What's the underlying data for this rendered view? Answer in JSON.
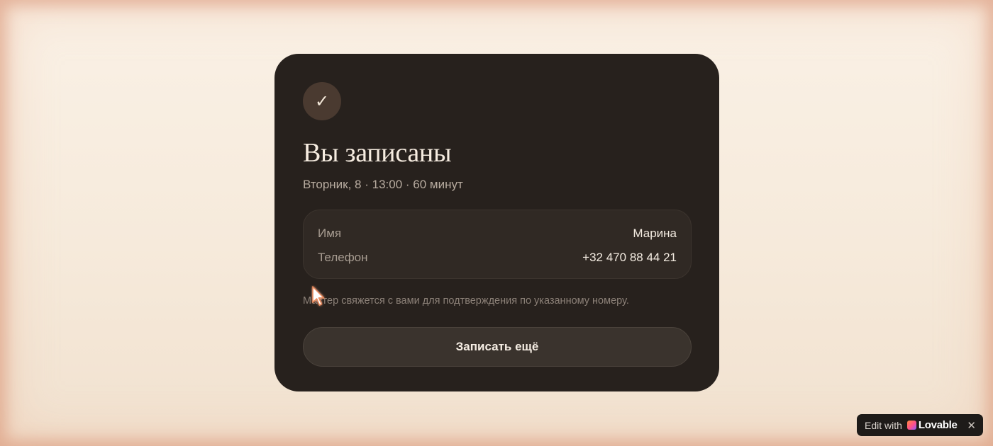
{
  "confirmation": {
    "check_glyph": "✓",
    "title": "Вы записаны",
    "subtitle": "Вторник, 8 · 13:00 · 60 минут",
    "details": [
      {
        "label": "Имя",
        "value": "Марина"
      },
      {
        "label": "Телефон",
        "value": "+32 470 88 44 21"
      }
    ],
    "note": "Мастер свяжется с вами для подтверждения по указанному номеру.",
    "book_again_label": "Записать ещё"
  },
  "lovable_badge": {
    "edit_text": "Edit with",
    "brand": "Lovable",
    "close_glyph": "✕"
  },
  "colors": {
    "card_bg": "#27211d",
    "page_bg": "#f6eadb",
    "accent_check_bg": "#4a3a30"
  }
}
